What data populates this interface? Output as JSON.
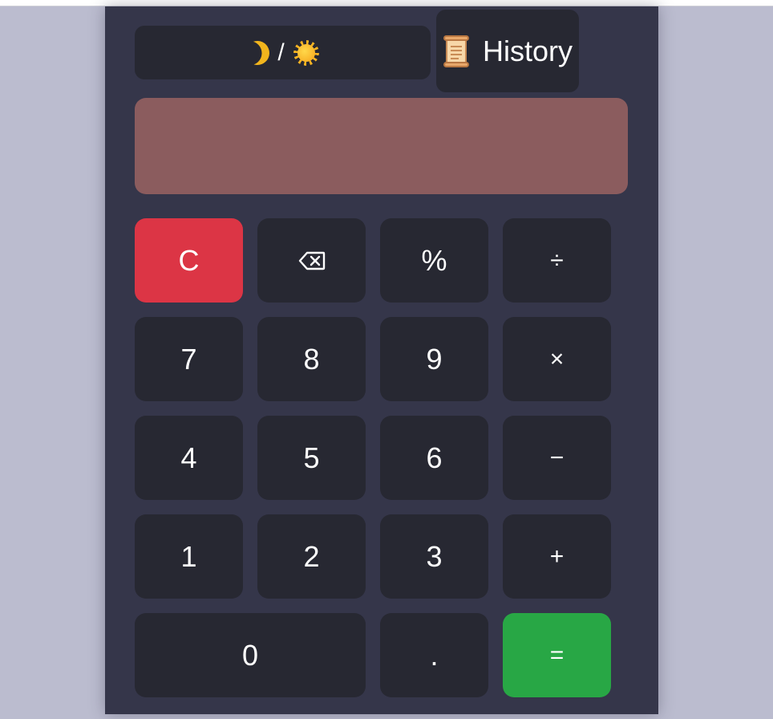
{
  "theme_toggle": {
    "separator": "/",
    "moon_icon": "moon-icon",
    "sun_icon": "sun-icon"
  },
  "history": {
    "label": "History",
    "icon": "scroll-icon"
  },
  "display": {
    "value": ""
  },
  "keys": {
    "clear": "C",
    "backspace_icon": "backspace-icon",
    "percent": "%",
    "divide": "÷",
    "seven": "7",
    "eight": "8",
    "nine": "9",
    "multiply": "×",
    "four": "4",
    "five": "5",
    "six": "6",
    "minus": "−",
    "one": "1",
    "two": "2",
    "three": "3",
    "plus": "+",
    "zero": "0",
    "decimal": ".",
    "equals": "="
  },
  "colors": {
    "background": "#bbbccf",
    "panel": "#35364a",
    "key": "#272832",
    "display": "#8b5c5e",
    "clear": "#dc3545",
    "equals": "#28a745"
  }
}
